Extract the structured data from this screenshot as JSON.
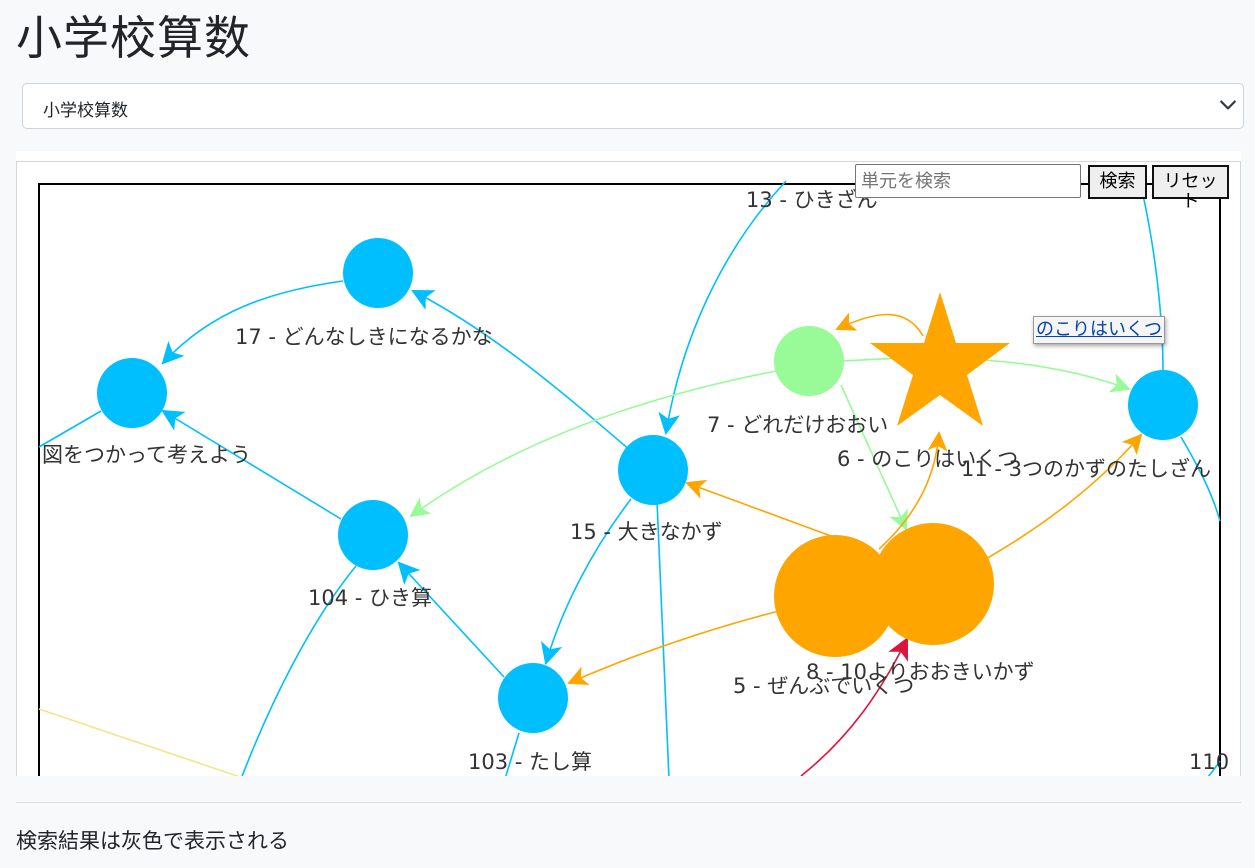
{
  "header": {
    "title": "小学校算数"
  },
  "selector": {
    "selected": "小学校算数"
  },
  "graph_controls": {
    "search_placeholder": "単元を検索",
    "search_button": "検索",
    "reset_button": "リセット"
  },
  "tooltip": {
    "text": "のこりはいくつ"
  },
  "nodes": [
    {
      "label": "13 - ひきざん",
      "color": "#00bfff"
    },
    {
      "label": "17 - どんなしきになるかな",
      "color": "#00bfff"
    },
    {
      "label": "図をつかって考えよう",
      "color": "#00bfff"
    },
    {
      "label": "7 - どれだけおおい",
      "color": "#98fb98"
    },
    {
      "label": "6 - のこりはいくつ",
      "color": "#ffa500"
    },
    {
      "label": "11 - 3つのかずのたしざん",
      "color": "#00bfff"
    },
    {
      "label": "15 - 大きなかず",
      "color": "#00bfff"
    },
    {
      "label": "104 - ひき算",
      "color": "#00bfff"
    },
    {
      "label": "5 - ぜんぶでいくつ",
      "color": "#ffa500"
    },
    {
      "label": "8 - 10よりおおきいかず",
      "color": "#ffa500"
    },
    {
      "label": "103 - たし算",
      "color": "#00bfff"
    },
    {
      "label": "110",
      "color": "#00bfff"
    }
  ],
  "edge_colors": {
    "blue": "#00bfff",
    "green": "#98fb98",
    "orange": "#ffa500",
    "red": "#dc143c",
    "yellow": "#f0e68c"
  },
  "footer": {
    "note": "検索結果は灰色で表示される"
  }
}
